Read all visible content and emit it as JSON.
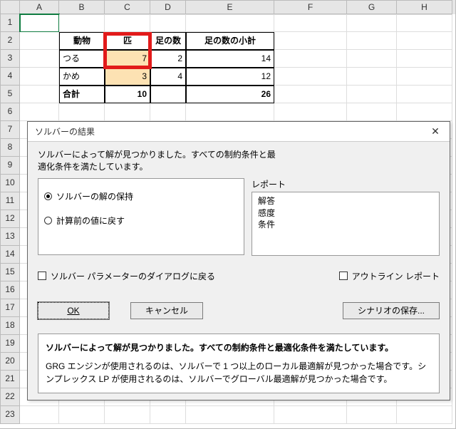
{
  "columns": [
    "A",
    "B",
    "C",
    "D",
    "E",
    "F",
    "G",
    "H"
  ],
  "row_count": 23,
  "selected_cell": "A1",
  "table": {
    "headers": {
      "animal": "動物",
      "count": "匹",
      "legs": "足の数",
      "leg_subtotal": "足の数の小計"
    },
    "rows": [
      {
        "animal": "つる",
        "count": 7,
        "legs": 2,
        "leg_subtotal": 14
      },
      {
        "animal": "かめ",
        "count": 3,
        "legs": 4,
        "leg_subtotal": 12
      }
    ],
    "total_label": "合計",
    "total_count": 10,
    "total_leg_subtotal": 26
  },
  "dialog": {
    "title": "ソルバーの結果",
    "message_line1": "ソルバーによって解が見つかりました。すべての制約条件と最",
    "message_line2": "適化条件を満たしています。",
    "radio": {
      "keep_label": "ソルバーの解の保持",
      "revert_label": "計算前の値に戻す",
      "selected": "keep"
    },
    "reports": {
      "label": "レポート",
      "items": [
        "解答",
        "感度",
        "条件"
      ]
    },
    "chk_return_label": "ソルバー パラメーターのダイアログに戻る",
    "chk_outline_label": "アウトライン レポート",
    "buttons": {
      "ok": "OK",
      "cancel": "キャンセル",
      "save_scenario": "シナリオの保存..."
    },
    "info_bold": "ソルバーによって解が見つかりました。すべての制約条件と最適化条件を満たしています。",
    "info_body": "GRG エンジンが使用されるのは、ソルバーで 1 つ以上のローカル最適解が見つかった場合です。シンプレックス LP が使用されるのは、ソルバーでグローバル最適解が見つかった場合です。"
  }
}
